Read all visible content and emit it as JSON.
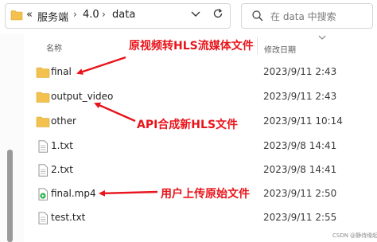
{
  "address_bar": {
    "nav_prefix": "«",
    "crumbs": [
      "服务端",
      "4.0",
      "data"
    ],
    "separator": "›"
  },
  "search": {
    "placeholder": "在 data 中搜索"
  },
  "columns": {
    "name": "名称",
    "date": "修改日期"
  },
  "files": [
    {
      "name": "final",
      "type": "folder",
      "date": "2023/9/11 2:43"
    },
    {
      "name": "output_video",
      "type": "folder",
      "date": "2023/9/11 2:43"
    },
    {
      "name": "other",
      "type": "folder",
      "date": "2023/9/11 10:14"
    },
    {
      "name": "1.txt",
      "type": "text",
      "date": "2023/9/8 14:41"
    },
    {
      "name": "2.txt",
      "type": "text",
      "date": "2023/9/8 14:41"
    },
    {
      "name": "final.mp4",
      "type": "video",
      "date": "2023/9/11 2:50"
    },
    {
      "name": "test.txt",
      "type": "text",
      "date": "2023/9/11 2:55"
    }
  ],
  "annotations": {
    "hls_conversion": "原视频转HLS流媒体文件",
    "api_output": "API合成新HLS文件",
    "user_upload": "用户上传原始文件"
  },
  "watermark": "CSDN @静待缘起",
  "colors": {
    "annotation": "#e8141b",
    "folder": "#f2c14e"
  }
}
